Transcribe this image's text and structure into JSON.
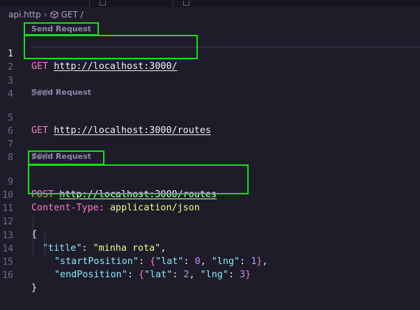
{
  "breadcrumb": {
    "file": "api.http",
    "request": "GET /"
  },
  "editor": {
    "codelens": [
      {
        "label": "Send Request",
        "before_line": 1
      },
      {
        "label": "Send Request",
        "before_line": 5
      },
      {
        "label": "Send Request",
        "before_line": 9
      }
    ],
    "lines": [
      {
        "n": "1",
        "method": "GET",
        "url": "http://localhost:3000/"
      },
      {
        "n": "2"
      },
      {
        "n": "3",
        "comment": "###"
      },
      {
        "n": "4"
      },
      {
        "n": "5",
        "method": "GET",
        "url": "http://localhost:3000/routes"
      },
      {
        "n": "6"
      },
      {
        "n": "7",
        "comment": "###"
      },
      {
        "n": "8"
      },
      {
        "n": "9",
        "method": "POST",
        "url": "http://localhost:3000/routes"
      },
      {
        "n": "10",
        "header_name": "Content-Type:",
        "header_value": "application/json"
      },
      {
        "n": "11"
      },
      {
        "n": "12",
        "text": "{"
      },
      {
        "n": "13",
        "key": "\"title\"",
        "value": "\"minha rota\""
      },
      {
        "n": "14",
        "key": "\"startPosition\"",
        "lat_key": "\"lat\"",
        "lat": "0",
        "lng_key": "\"lng\"",
        "lng": "1"
      },
      {
        "n": "15",
        "key": "\"endPosition\"",
        "lat_key": "\"lat\"",
        "lat": "2",
        "lng_key": "\"lng\"",
        "lng": "3"
      },
      {
        "n": "16",
        "text": "}"
      }
    ]
  },
  "colors": {
    "background": "#1e1c28",
    "keyword": "#ff79c6",
    "string": "#f1fa8c",
    "property": "#8be9fd",
    "number": "#bd93f9",
    "highlight_box": "#17e017"
  }
}
